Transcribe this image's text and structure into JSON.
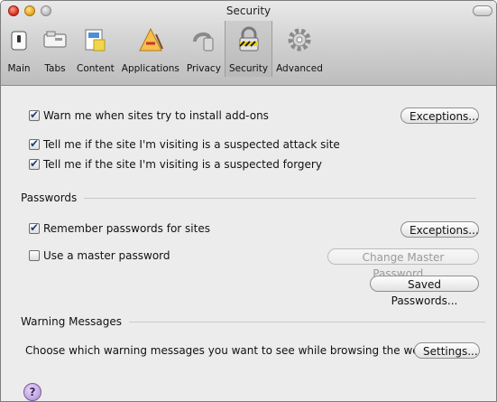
{
  "window": {
    "title": "Security"
  },
  "toolbar": {
    "items": [
      {
        "label": "Main",
        "icon": "switch-icon"
      },
      {
        "label": "Tabs",
        "icon": "tabs-icon"
      },
      {
        "label": "Content",
        "icon": "content-icon"
      },
      {
        "label": "Applications",
        "icon": "applications-icon"
      },
      {
        "label": "Privacy",
        "icon": "privacy-key-icon"
      },
      {
        "label": "Security",
        "icon": "security-lock-icon",
        "selected": true
      },
      {
        "label": "Advanced",
        "icon": "gear-icon"
      }
    ]
  },
  "general": {
    "warn_addons": {
      "label": "Warn me when sites try to install add-ons",
      "checked": true
    },
    "attack_site": {
      "label": "Tell me if the site I'm visiting is a suspected attack site",
      "checked": true
    },
    "forgery": {
      "label": "Tell me if the site I'm visiting is a suspected forgery",
      "checked": true
    },
    "exceptions_label": "Exceptions..."
  },
  "passwords": {
    "heading": "Passwords",
    "remember": {
      "label": "Remember passwords for sites",
      "checked": true
    },
    "master": {
      "label": "Use a master password",
      "checked": false
    },
    "exceptions_label": "Exceptions...",
    "change_master_label": "Change Master Password...",
    "saved_label": "Saved Passwords..."
  },
  "warnings": {
    "heading": "Warning Messages",
    "description": "Choose which warning messages you want to see while browsing the web",
    "settings_label": "Settings..."
  },
  "help": {
    "label": "?"
  }
}
